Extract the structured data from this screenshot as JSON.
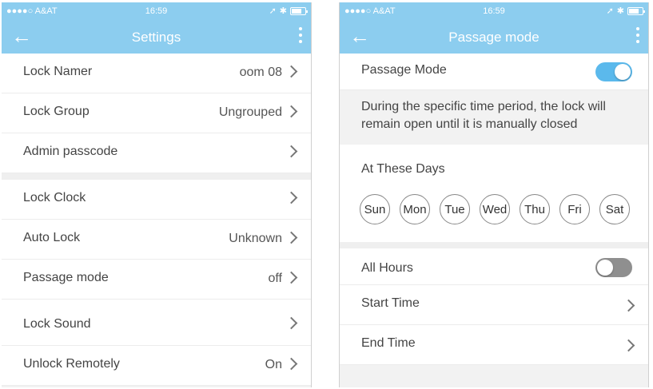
{
  "status_bar": {
    "carrier": "●●●●○ A&AT",
    "time": "16:59",
    "location_glyph": "➚",
    "bluetooth_glyph": "✱"
  },
  "icons": {
    "back": "←"
  },
  "colors": {
    "nav_bar": "#8ccdef",
    "toggle_on": "#5bb9ec",
    "toggle_off": "#8f8f8f"
  },
  "settings": {
    "title": "Settings",
    "group1": [
      {
        "label": "Lock Namer",
        "value": "oom 08"
      },
      {
        "label": "Lock Group",
        "value": "Ungrouped"
      },
      {
        "label": "Admin passcode",
        "value": ""
      }
    ],
    "group2": [
      {
        "label": "Lock Clock",
        "value": ""
      },
      {
        "label": "Auto Lock",
        "value": "Unknown"
      },
      {
        "label": "Passage mode",
        "value": "off"
      },
      {
        "label": "Lock Sound",
        "value": ""
      },
      {
        "label": "Unlock Remotely",
        "value": "On"
      }
    ]
  },
  "passage": {
    "title": "Passage mode",
    "mode_label": "Passage Mode",
    "mode_on": true,
    "description": "During the specific time period, the lock will remain open until it is manually closed",
    "days_title": "At These Days",
    "days": [
      "Sun",
      "Mon",
      "Tue",
      "Wed",
      "Thu",
      "Fri",
      "Sat"
    ],
    "all_hours_label": "All Hours",
    "all_hours_on": false,
    "start_time_label": "Start Time",
    "end_time_label": "End Time"
  }
}
